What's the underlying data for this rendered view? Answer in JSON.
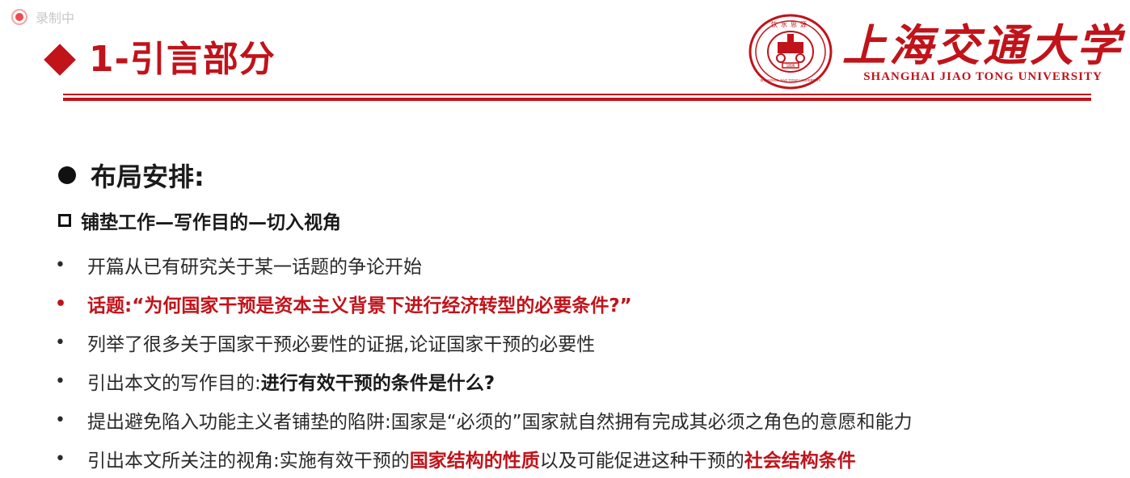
{
  "recording": {
    "label": "录制中"
  },
  "title": {
    "text": "1-引言部分"
  },
  "logo": {
    "name_cn": "上海交通大学",
    "name_en": "SHANGHAI JIAO TONG UNIVERSITY",
    "seal_top": "饮水思源",
    "seal_bottom": "SHANGHAI JIAO TONG UNIVERSITY",
    "seal_year": "1896"
  },
  "heading": "布局安排:",
  "subheading": "铺垫工作—写作目的—切入视角",
  "bullets": {
    "b1": "开篇从已有研究关于某一话题的争论开始",
    "b2": "话题:“为何国家干预是资本主义背景下进行经济转型的必要条件?”",
    "b3": "列举了很多关于国家干预必要性的证据,论证国家干预的必要性",
    "b4_prefix": "引出本文的写作目的:",
    "b4_bold": "进行有效干预的条件是什么?",
    "b5": "提出避免陷入功能主义者铺垫的陷阱:国家是“必须的”国家就自然拥有完成其必须之角色的意愿和能力",
    "b6_prefix": "引出本文所关注的视角:实施有效干预的",
    "b6_hl1": "国家结构的性质",
    "b6_mid": "以及可能促进这种干预的",
    "b6_hl2": "社会结构条件"
  },
  "colors": {
    "accent": "#c1131a",
    "text": "#222222",
    "recording": "#ef4a50"
  }
}
